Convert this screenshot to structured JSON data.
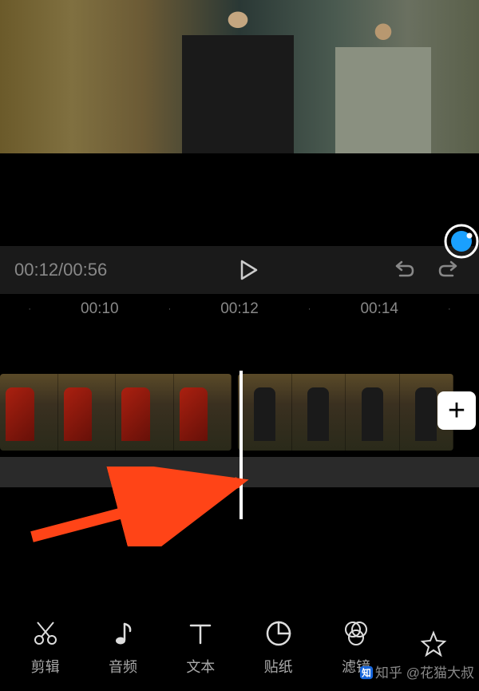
{
  "playback": {
    "current_time": "00:12",
    "total_time": "00:56",
    "timecode_display": "00:12/00:56"
  },
  "ruler": {
    "labels": [
      "00:10",
      "00:12",
      "00:14"
    ]
  },
  "toolbar": {
    "items": [
      {
        "id": "cut",
        "label": "剪辑"
      },
      {
        "id": "audio",
        "label": "音频"
      },
      {
        "id": "text",
        "label": "文本"
      },
      {
        "id": "sticker",
        "label": "贴纸"
      },
      {
        "id": "filter",
        "label": "滤镜"
      }
    ]
  },
  "add_clip_label": "+",
  "watermark": {
    "platform": "知乎",
    "author": "@花猫大叔"
  },
  "colors": {
    "accent_blue": "#1aa0ff",
    "arrow": "#ff4417"
  }
}
